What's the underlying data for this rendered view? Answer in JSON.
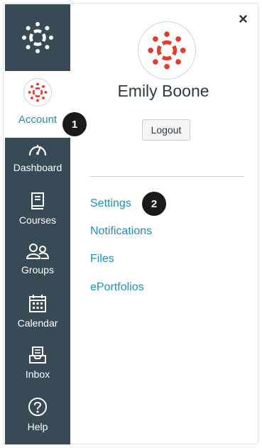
{
  "colors": {
    "sidebar_bg": "#384a55",
    "link": "#1e8fbf",
    "brand_red": "#e63b2e",
    "badge_bg": "#1a1a1a"
  },
  "sidebar": {
    "logo_icon": "canvas-logo-icon",
    "account": {
      "label": "Account",
      "icon": "canvas-avatar-icon"
    },
    "items": [
      {
        "label": "Dashboard",
        "icon": "speedometer-icon"
      },
      {
        "label": "Courses",
        "icon": "book-icon"
      },
      {
        "label": "Groups",
        "icon": "people-icon"
      },
      {
        "label": "Calendar",
        "icon": "calendar-icon"
      },
      {
        "label": "Inbox",
        "icon": "inbox-icon"
      },
      {
        "label": "Help",
        "icon": "help-icon"
      }
    ]
  },
  "tray": {
    "close_symbol": "×",
    "user_name": "Emily Boone",
    "logout_label": "Logout",
    "links": [
      "Settings",
      "Notifications",
      "Files",
      "ePortfolios"
    ]
  },
  "badges": [
    "1",
    "2"
  ]
}
